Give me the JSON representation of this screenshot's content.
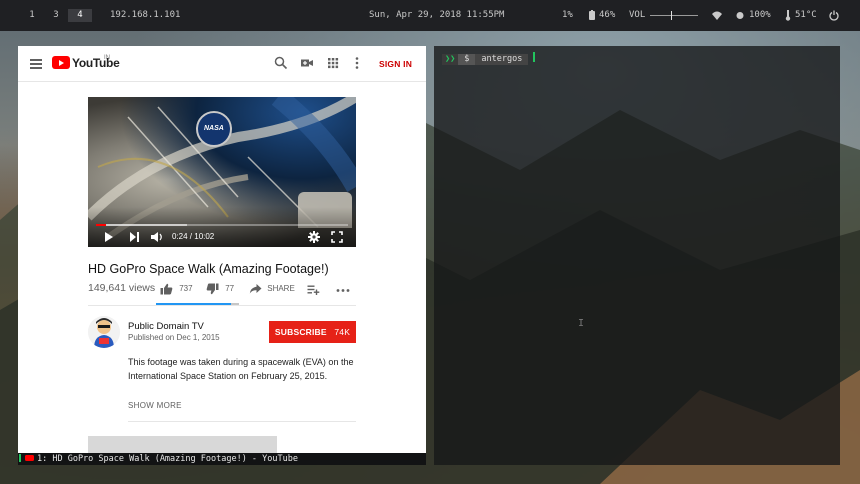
{
  "topbar": {
    "workspaces": [
      {
        "label": "1",
        "active": false
      },
      {
        "label": "3",
        "active": false
      },
      {
        "label": "4",
        "active": true
      }
    ],
    "ip": "192.168.1.101",
    "datetime": "Sun, Apr 29, 2018 11:55PM",
    "cpu": "1%",
    "battery": "46%",
    "volume_label": "VOL",
    "brightness": "100%",
    "temperature": "51°C",
    "icons": [
      "battery-icon",
      "wifi-icon",
      "brightness-icon",
      "thermometer-icon",
      "power-icon"
    ]
  },
  "youtube": {
    "logo_text": "YouTube",
    "country": "IN",
    "signin": "SIGN IN",
    "video": {
      "time": "0:24 / 10:02",
      "progress": 0.04,
      "buffered": 0.36
    },
    "title": "HD GoPro Space Walk (Amazing Footage!)",
    "views": "149,641 views",
    "likes": "737",
    "dislikes": "77",
    "like_ratio": 0.905,
    "share_label": "SHARE",
    "channel": "Public Domain TV",
    "published": "Published on Dec 1, 2015",
    "subscribe_label": "SUBSCRIBE",
    "subscriber_count": "74K",
    "description": "This footage was taken during a spacewalk (EVA) on the International Space Station on February 25, 2015.",
    "show_more": "SHOW MORE"
  },
  "statusline": {
    "text": "1: HD GoPro Space Walk (Amazing Footage!) - YouTube"
  },
  "terminal": {
    "symbol": "$",
    "hostname": "antergos"
  },
  "colors": {
    "youtube_red": "#ff0000",
    "subscribe_red": "#e62117",
    "prompt_green": "#22c55e",
    "like_blue": "#2196f3"
  }
}
